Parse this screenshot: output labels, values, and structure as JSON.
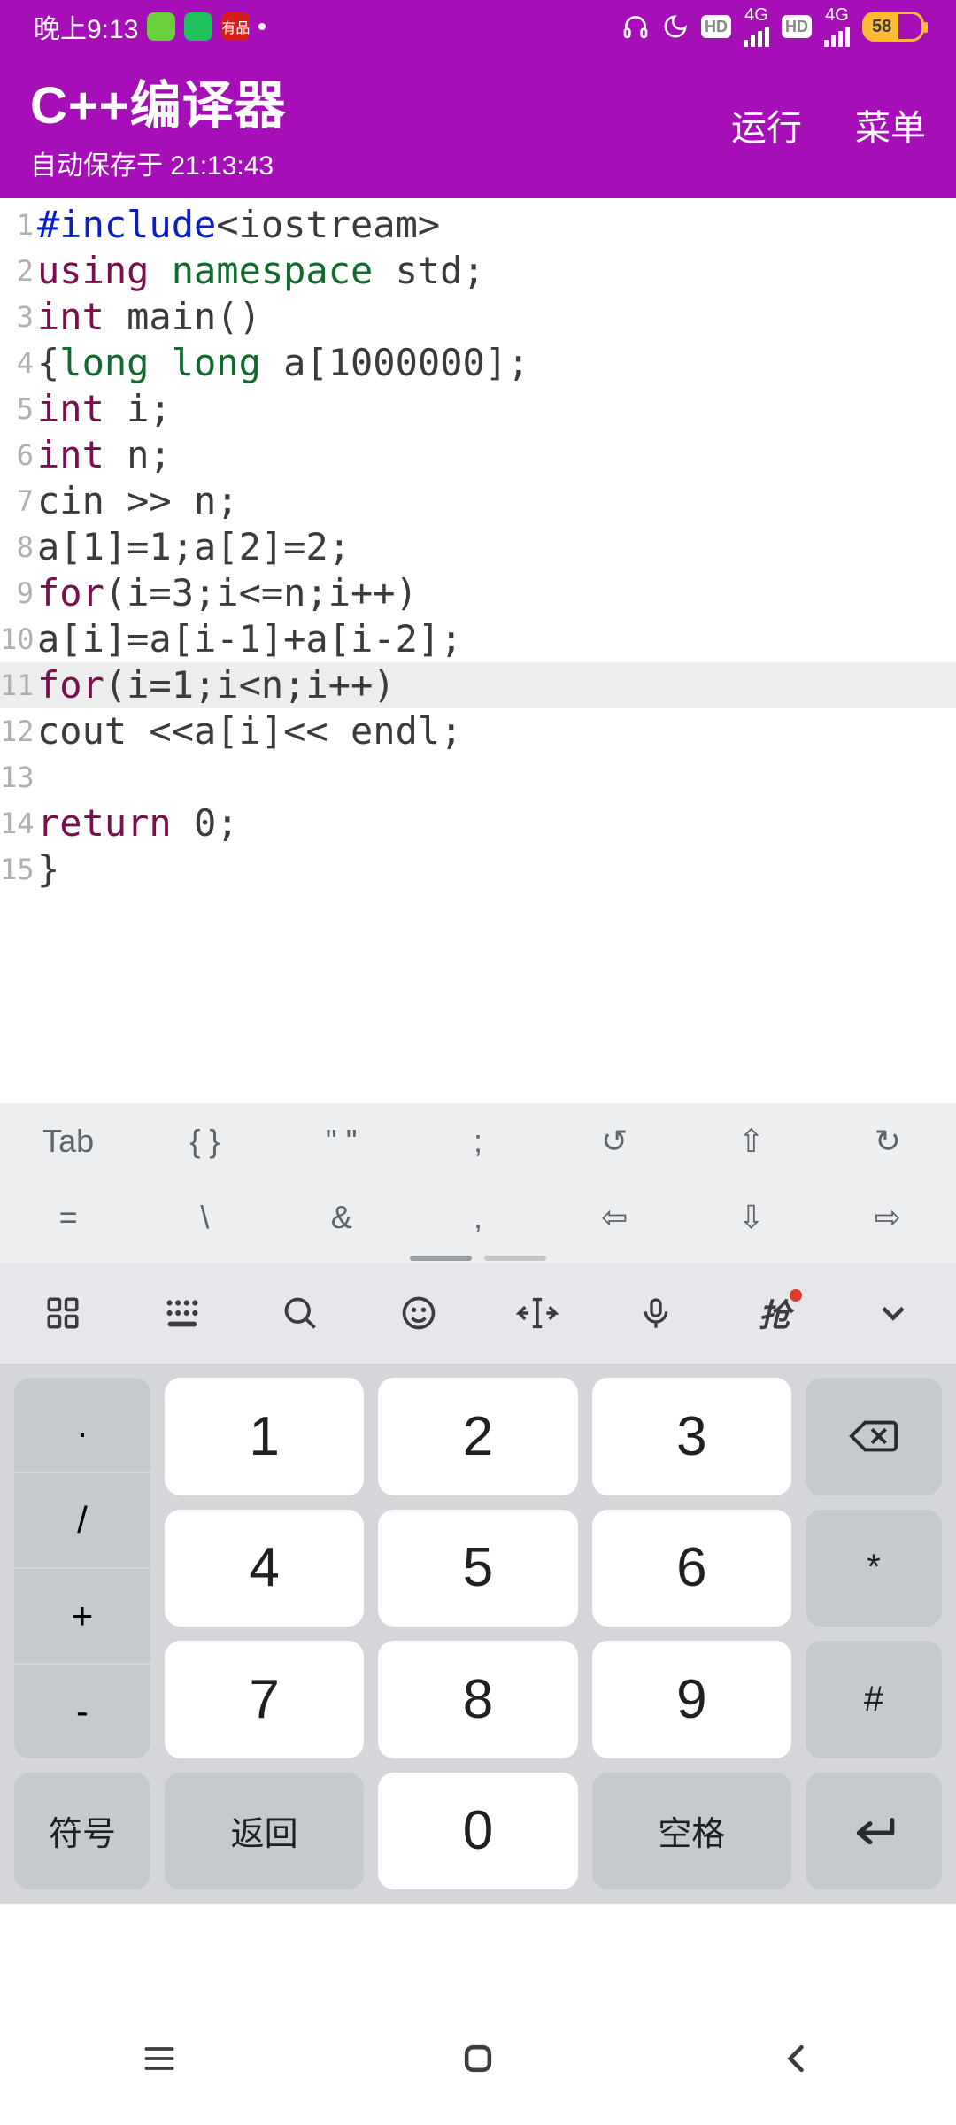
{
  "statusbar": {
    "time": "晚上9:13",
    "battery_pct": "58",
    "youpin_label": "有品",
    "hd1": "HD",
    "hd2": "HD",
    "net": "4G"
  },
  "appbar": {
    "title": "C++编译器",
    "subtitle": "自动保存于 21:13:43",
    "run": "运行",
    "menu": "菜单"
  },
  "code": {
    "lines": [
      {
        "n": "1",
        "hl": false,
        "tokens": [
          [
            "pre",
            "#include"
          ],
          [
            "str",
            "<iostream>"
          ]
        ]
      },
      {
        "n": "2",
        "hl": false,
        "tokens": [
          [
            "kw",
            "using "
          ],
          [
            "ns",
            "namespace"
          ],
          [
            "str",
            " std;"
          ]
        ]
      },
      {
        "n": "3",
        "hl": false,
        "tokens": [
          [
            "kw",
            "int"
          ],
          [
            "str",
            " main()"
          ]
        ]
      },
      {
        "n": "4",
        "hl": false,
        "tokens": [
          [
            "str",
            "{"
          ],
          [
            "ns",
            "long long"
          ],
          [
            "str",
            " a[1000000];"
          ]
        ]
      },
      {
        "n": "5",
        "hl": false,
        "tokens": [
          [
            "kw",
            "int"
          ],
          [
            "str",
            " i;"
          ]
        ]
      },
      {
        "n": "6",
        "hl": false,
        "tokens": [
          [
            "kw",
            "int"
          ],
          [
            "str",
            " n;"
          ]
        ]
      },
      {
        "n": "7",
        "hl": false,
        "tokens": [
          [
            "str",
            "cin >> n;"
          ]
        ]
      },
      {
        "n": "8",
        "hl": false,
        "tokens": [
          [
            "str",
            "a[1]=1;a[2]=2;"
          ]
        ]
      },
      {
        "n": "9",
        "hl": false,
        "tokens": [
          [
            "kw",
            "for"
          ],
          [
            "str",
            "(i=3;i<=n;i++)"
          ]
        ]
      },
      {
        "n": "10",
        "hl": false,
        "tokens": [
          [
            "str",
            "a[i]=a[i-1]+a[i-2];"
          ]
        ]
      },
      {
        "n": "11",
        "hl": true,
        "tokens": [
          [
            "kw",
            "for"
          ],
          [
            "str",
            "(i=1;i<n;i++)"
          ]
        ]
      },
      {
        "n": "12",
        "hl": false,
        "tokens": [
          [
            "str",
            "cout <<a[i]<< endl;"
          ]
        ]
      },
      {
        "n": "13",
        "hl": false,
        "tokens": [
          [
            "str",
            ""
          ]
        ]
      },
      {
        "n": "14",
        "hl": false,
        "tokens": [
          [
            "kw",
            "return"
          ],
          [
            "str",
            " 0;"
          ]
        ]
      },
      {
        "n": "15",
        "hl": false,
        "tokens": [
          [
            "str",
            "}"
          ]
        ]
      }
    ]
  },
  "symbar": {
    "row1": [
      "Tab",
      "{ }",
      "\" \"",
      ";",
      "↺",
      "⇧",
      "↻"
    ],
    "row2": [
      "=",
      "\\",
      "&",
      ",",
      "⇦",
      "⇩",
      "⇨"
    ]
  },
  "ime_top": {
    "grid_icon": "grid",
    "keyboard_icon": "keyboard",
    "search_icon": "search",
    "emoji_icon": "emoji",
    "cursor_icon": "cursor",
    "mic_icon": "mic",
    "grab_label": "抢",
    "chev": "chevron"
  },
  "keypad": {
    "left": [
      ".",
      "/",
      "+",
      "-"
    ],
    "nums": [
      "1",
      "2",
      "3",
      "4",
      "5",
      "6",
      "7",
      "8",
      "9"
    ],
    "zero": "0",
    "symbol": "符号",
    "back_word": "返回",
    "space": "空格",
    "star": "*",
    "hash": "#"
  }
}
